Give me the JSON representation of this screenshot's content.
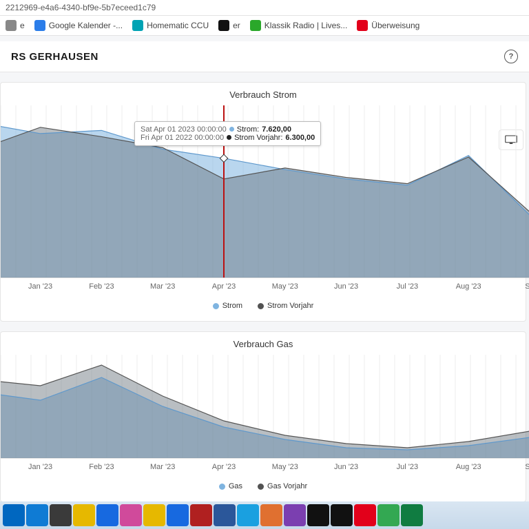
{
  "url_fragment": "2212969-e4a6-4340-bf9e-5b7eceed1c79",
  "bookmarks": [
    {
      "label": "e",
      "color": "#888"
    },
    {
      "label": "Google Kalender -...",
      "color": "#2b7de9"
    },
    {
      "label": "Homematic CCU",
      "color": "#00a3b4"
    },
    {
      "label": "er",
      "color": "#111"
    },
    {
      "label": "Klassik Radio | Lives...",
      "color": "#2aa82a"
    },
    {
      "label": "Überweisung",
      "color": "#e2001a"
    }
  ],
  "header_title": "RS GERHAUSEN",
  "chart_data": [
    {
      "type": "area",
      "title": "Verbrauch Strom",
      "legend": [
        {
          "name": "Strom",
          "color": "#7fb4e0"
        },
        {
          "name": "Strom Vorjahr",
          "color": "#525252"
        }
      ],
      "categories": [
        "Jan '23",
        "Feb '23",
        "Mar '23",
        "Apr '23",
        "May '23",
        "Jun '23",
        "Jul '23",
        "Aug '23",
        "Se"
      ],
      "series": [
        {
          "name": "Strom",
          "color": "#7fb4e0",
          "values": [
            9200,
            9400,
            8200,
            7620,
            6900,
            6300,
            5900,
            7800,
            4000
          ]
        },
        {
          "name": "Strom Vorjahr",
          "color": "#6b727a",
          "values": [
            9600,
            9000,
            8300,
            6300,
            7000,
            6400,
            6000,
            7700,
            4200
          ]
        }
      ],
      "pre": {
        "strom": [
          8400,
          9900
        ],
        "vorjahr": [
          9200,
          8200
        ]
      },
      "ylim": [
        0,
        11000
      ],
      "tooltip": {
        "x_index": 3,
        "lines": [
          {
            "ts": "Sat Apr 01 2023 00:00:00",
            "marker": "#7fb4e0",
            "label": "Strom",
            "value": "7.620,00"
          },
          {
            "ts": "Fri Apr 01 2022 00:00:00",
            "marker": "#222",
            "label": "Strom Vorjahr",
            "value": "6.300,00"
          }
        ]
      }
    },
    {
      "type": "area",
      "title": "Verbrauch Gas",
      "legend": [
        {
          "name": "Gas",
          "color": "#7fb4e0"
        },
        {
          "name": "Gas Vorjahr",
          "color": "#525252"
        }
      ],
      "categories": [
        "Jan '23",
        "Feb '23",
        "Mar '23",
        "Apr '23",
        "May '23",
        "Jun '23",
        "Jul '23",
        "Aug '23",
        "Se"
      ],
      "series": [
        {
          "name": "Gas",
          "color": "#7fb4e0",
          "values": [
            56,
            78,
            50,
            30,
            18,
            10,
            8,
            12,
            20
          ]
        },
        {
          "name": "Gas Vorjahr",
          "color": "#6b727a",
          "values": [
            70,
            90,
            60,
            36,
            22,
            14,
            10,
            16,
            26
          ]
        }
      ],
      "pre": {
        "strom": [
          48,
          64
        ],
        "vorjahr": [
          60,
          76
        ]
      },
      "ylim": [
        0,
        100
      ]
    }
  ],
  "taskbar_icons": [
    "start",
    "edge",
    "calc",
    "files",
    "loxone",
    "snip",
    "explorer",
    "mail",
    "m3",
    "word",
    "photos",
    "paint",
    "clipchamp",
    "term",
    "ssh",
    "opera",
    "chrome",
    "excel"
  ]
}
